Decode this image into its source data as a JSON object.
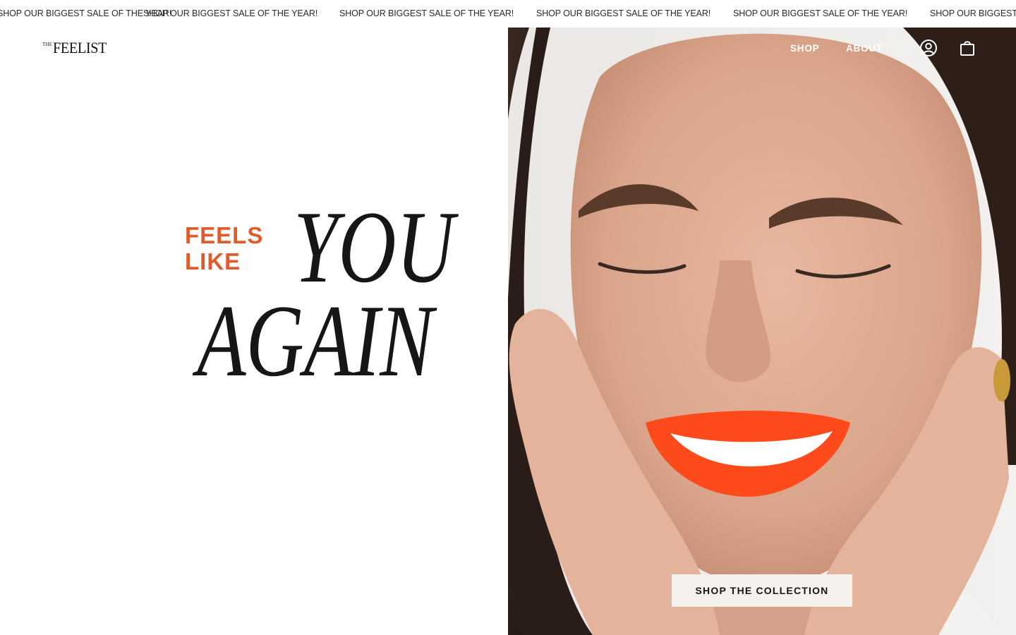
{
  "announcement": {
    "text": "SHOP OUR BIGGEST SALE OF THE YEAR!",
    "items": [
      "SHOP OUR BIGGEST SALE OF THE YEAR!",
      "SHOP OUR BIGGEST SALE OF THE YEAR!",
      "SHOP OUR BIGGEST SALE OF THE YEAR!",
      "SHOP OUR BIGGEST SALE OF THE YEAR!",
      "SHOP OUR BIGGEST SALE OF THE YEAR!",
      "SHOP OUR BIGGEST SALE OF THE YEAR!"
    ]
  },
  "header": {
    "logo_small": "THE",
    "logo_main": "FEELIST",
    "nav": [
      {
        "label": "SHOP"
      },
      {
        "label": "ABOUT"
      }
    ],
    "account_icon": "account-icon",
    "cart_icon": "shopping-bag-icon"
  },
  "hero": {
    "line_small_1": "FEELS",
    "line_small_2": "LIKE",
    "line_big_1": "YOU",
    "line_big_2": "AGAIN",
    "cta_label": "SHOP THE COLLECTION"
  },
  "colors": {
    "accent": "#e15b2b",
    "text": "#161616",
    "cta_background": "#f5f1ec",
    "nav_text": "#ffffff"
  }
}
